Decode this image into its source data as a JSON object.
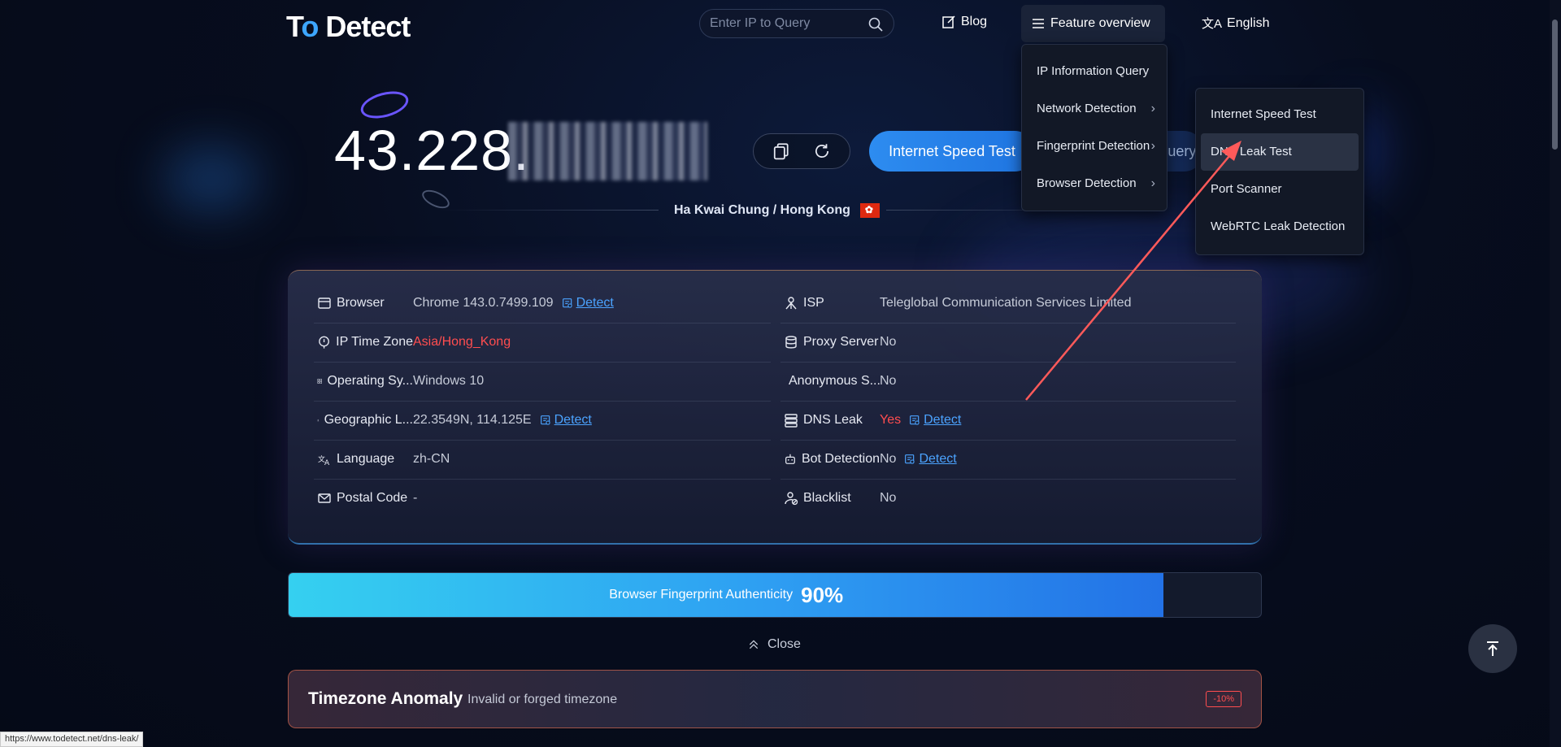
{
  "header": {
    "logo": {
      "part1": "T",
      "part2": "o",
      "part3": " Detect"
    },
    "search_placeholder": "Enter IP to Query",
    "blog_label": "Blog",
    "feature_label": "Feature overview",
    "language_label": "English"
  },
  "feature_menu": {
    "items": [
      {
        "label": "IP Information Query",
        "has_submenu": false
      },
      {
        "label": "Network Detection",
        "has_submenu": true
      },
      {
        "label": "Fingerprint Detection",
        "has_submenu": true
      },
      {
        "label": "Browser Detection",
        "has_submenu": true
      }
    ],
    "chevron": "›"
  },
  "network_submenu": {
    "items": [
      {
        "label": "Internet Speed Test"
      },
      {
        "label": "DNS Leak Test",
        "active": true
      },
      {
        "label": "Port Scanner"
      },
      {
        "label": "WebRTC Leak Detection"
      }
    ]
  },
  "ip_section": {
    "ip_visible": "43.228.",
    "ip_masked": "227.199",
    "speed_test_button": "Internet Speed Test",
    "ip_info_button": "IP Information Query",
    "location": "Ha Kwai Chung / Hong Kong",
    "flag": "Hong Kong"
  },
  "info_card": {
    "left": [
      {
        "icon": "browser-icon",
        "label": "Browser",
        "value": "Chrome 143.0.7499.109",
        "value_color": "normal",
        "detect": "Detect"
      },
      {
        "icon": "location-pin-icon",
        "label": "IP Time Zone",
        "value": "Asia/Hong_Kong",
        "value_color": "red",
        "detect": ""
      },
      {
        "icon": "grid-icon",
        "label": "Operating Sy...",
        "value": "Windows 10",
        "value_color": "normal",
        "detect": ""
      },
      {
        "icon": "map-pin-icon",
        "label": "Geographic L...",
        "value": "22.3549N, 114.125E",
        "value_color": "normal",
        "detect": "Detect"
      },
      {
        "icon": "translate-icon",
        "label": "Language",
        "value": "zh-CN",
        "value_color": "normal",
        "detect": ""
      },
      {
        "icon": "mail-icon",
        "label": "Postal Code",
        "value": "-",
        "value_color": "normal",
        "detect": ""
      }
    ],
    "right": [
      {
        "icon": "user-network-icon",
        "label": "ISP",
        "value": "Teleglobal Communication Services Limited",
        "value_color": "normal",
        "detect": ""
      },
      {
        "icon": "database-icon",
        "label": "Proxy Server",
        "value": "No",
        "value_color": "normal",
        "detect": ""
      },
      {
        "icon": "id-card-icon",
        "label": "Anonymous S...",
        "value": "No",
        "value_color": "normal",
        "detect": ""
      },
      {
        "icon": "server-icon",
        "label": "DNS Leak",
        "value": "Yes",
        "value_color": "red",
        "detect": "Detect"
      },
      {
        "icon": "robot-icon",
        "label": "Bot Detection",
        "value": "No",
        "value_color": "normal",
        "detect": "Detect"
      },
      {
        "icon": "user-block-icon",
        "label": "Blacklist",
        "value": "No",
        "value_color": "normal",
        "detect": ""
      }
    ]
  },
  "fingerprint": {
    "label": "Browser Fingerprint Authenticity",
    "value_text": "90%",
    "percent": 90
  },
  "close_label": "Close",
  "anomaly": {
    "title": "Timezone Anomaly",
    "description": "Invalid or forged timezone",
    "badge": "-10%"
  },
  "status_url": "https://www.todetect.net/dns-leak/",
  "colors": {
    "accent": "#2d8cf0",
    "danger": "#ff4d4f",
    "link": "#4ba3ff",
    "annotation_arrow": "#ff5a5a"
  }
}
